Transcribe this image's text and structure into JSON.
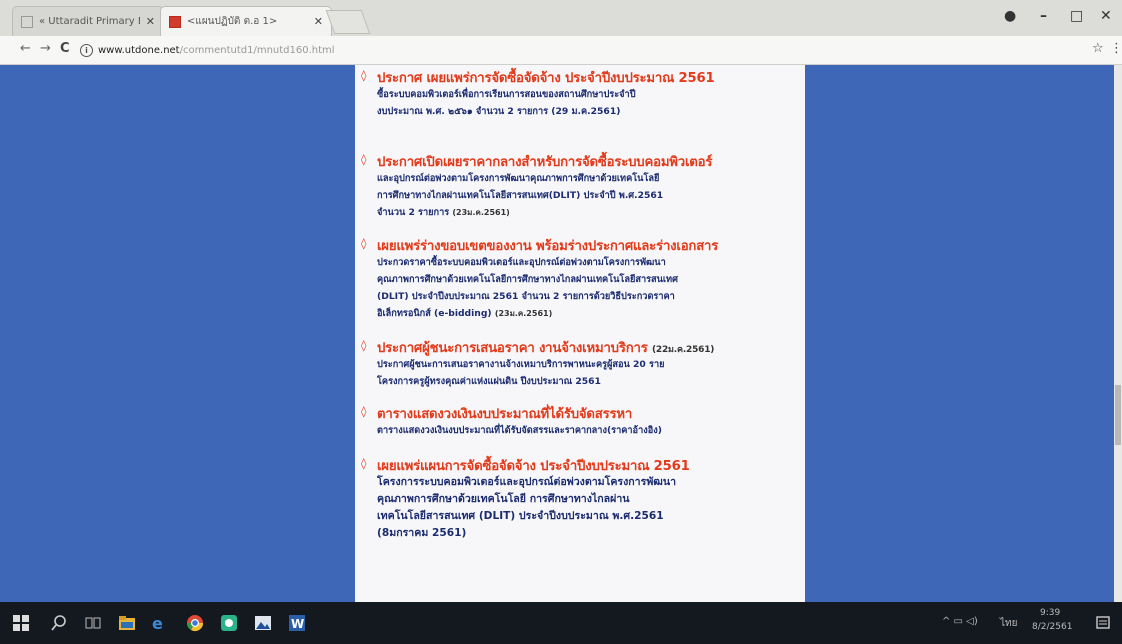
{
  "browser": {
    "tabs": [
      {
        "title": "« Uttaradit Primary Educ"
      },
      {
        "title": "<แผนปฏิบัติ ต.อ 1>"
      }
    ],
    "url_host": "www.utdone.net",
    "url_path": "/commentutd1/mnutd160.html",
    "window_controls": {
      "minimize": "–",
      "maximize": "□",
      "close": "✕"
    }
  },
  "announcements": [
    {
      "title": "ประกาศ เผยแพร่การจัดซื้อจัดจ้าง ประจำปีงบประมาณ 2561",
      "title_date": "",
      "lines": [
        "ซื้อระบบคอมพิวเตอร์เพื่อการเรียนการสอนของสถานศึกษาประจำปี",
        "งบประมาณ พ.ศ. ๒๕๖๑ จำนวน 2 รายการ (29 ม.ค.2561)"
      ],
      "date": ""
    },
    {
      "title": "ประกาศเปิดเผยราคากลางสำหรับการจัดซื้อระบบคอมพิวเตอร์",
      "title_date": "",
      "lines": [
        "และอุปกรณ์ต่อพ่วงตามโครงการพัฒนาคุณภาพการศึกษาด้วยเทคโนโลยี",
        "การศึกษาทางไกลผ่านเทคโนโลยีสารสนเทศ(DLIT) ประจำปี พ.ศ.2561",
        "จำนวน 2 รายการ"
      ],
      "date": "(23ม.ค.2561)"
    },
    {
      "title": "เผยแพร่ร่างขอบเขตของงาน พร้อมร่างประกาศและร่างเอกสาร",
      "title_date": "",
      "lines": [
        "ประกวดราคาซื้อระบบคอมพิวเตอร์และอุปกรณ์ต่อพ่วงตามโครงการพัฒนา",
        "คุณภาพการศึกษาด้วยเทคโนโลยีการศึกษาทางไกลผ่านเทคโนโลยีสารสนเทศ",
        "(DLIT) ประจำปีงบประมาณ 2561 จำนวน 2 รายการด้วยวิธีประกวดราคา",
        "อิเล็กทรอนิกส์ (e-bidding)"
      ],
      "date": "(23ม.ค.2561)"
    },
    {
      "title": "ประกาศผู้ชนะการเสนอราคา งานจ้างเหมาบริการ",
      "title_date": "(22ม.ค.2561)",
      "lines": [
        "ประกาศผู้ชนะการเสนอราคางานจ้างเหมาบริการพาหนะครูผู้สอน 20 ราย",
        "โครงการครูผู้ทรงคุณค่าแห่งแผ่นดิน ปีงบประมาณ 2561"
      ],
      "date": ""
    },
    {
      "title": "ตารางแสดงวงเงินงบประมาณที่ได้รับจัดสรรหา",
      "title_date": "",
      "lines": [
        "ตารางแสดงวงเงินงบประมาณที่ได้รับจัดสรรและราคากลาง(ราคาอ้างอิง)"
      ],
      "date": ""
    },
    {
      "title": "เผยแพร่แผนการจัดซื้อจัดจ้าง ประจำปีงบประมาณ 2561",
      "title_date": "",
      "lines": [
        "โครงการระบบคอมพิวเตอร์และอุปกรณ์ต่อพ่วงตามโครงการพัฒนา",
        "คุณภาพการศึกษาด้วยเทคโนโลยี การศึกษาทางไกลผ่าน",
        "เทคโนโลยีสารสนเทศ (DLIT) ประจำปีงบประมาณ พ.ศ.2561",
        "(8มกราคม 2561)"
      ],
      "date": ""
    }
  ],
  "taskbar": {
    "time": "9:39",
    "date": "8/2/2561",
    "lang": "ไทย"
  }
}
